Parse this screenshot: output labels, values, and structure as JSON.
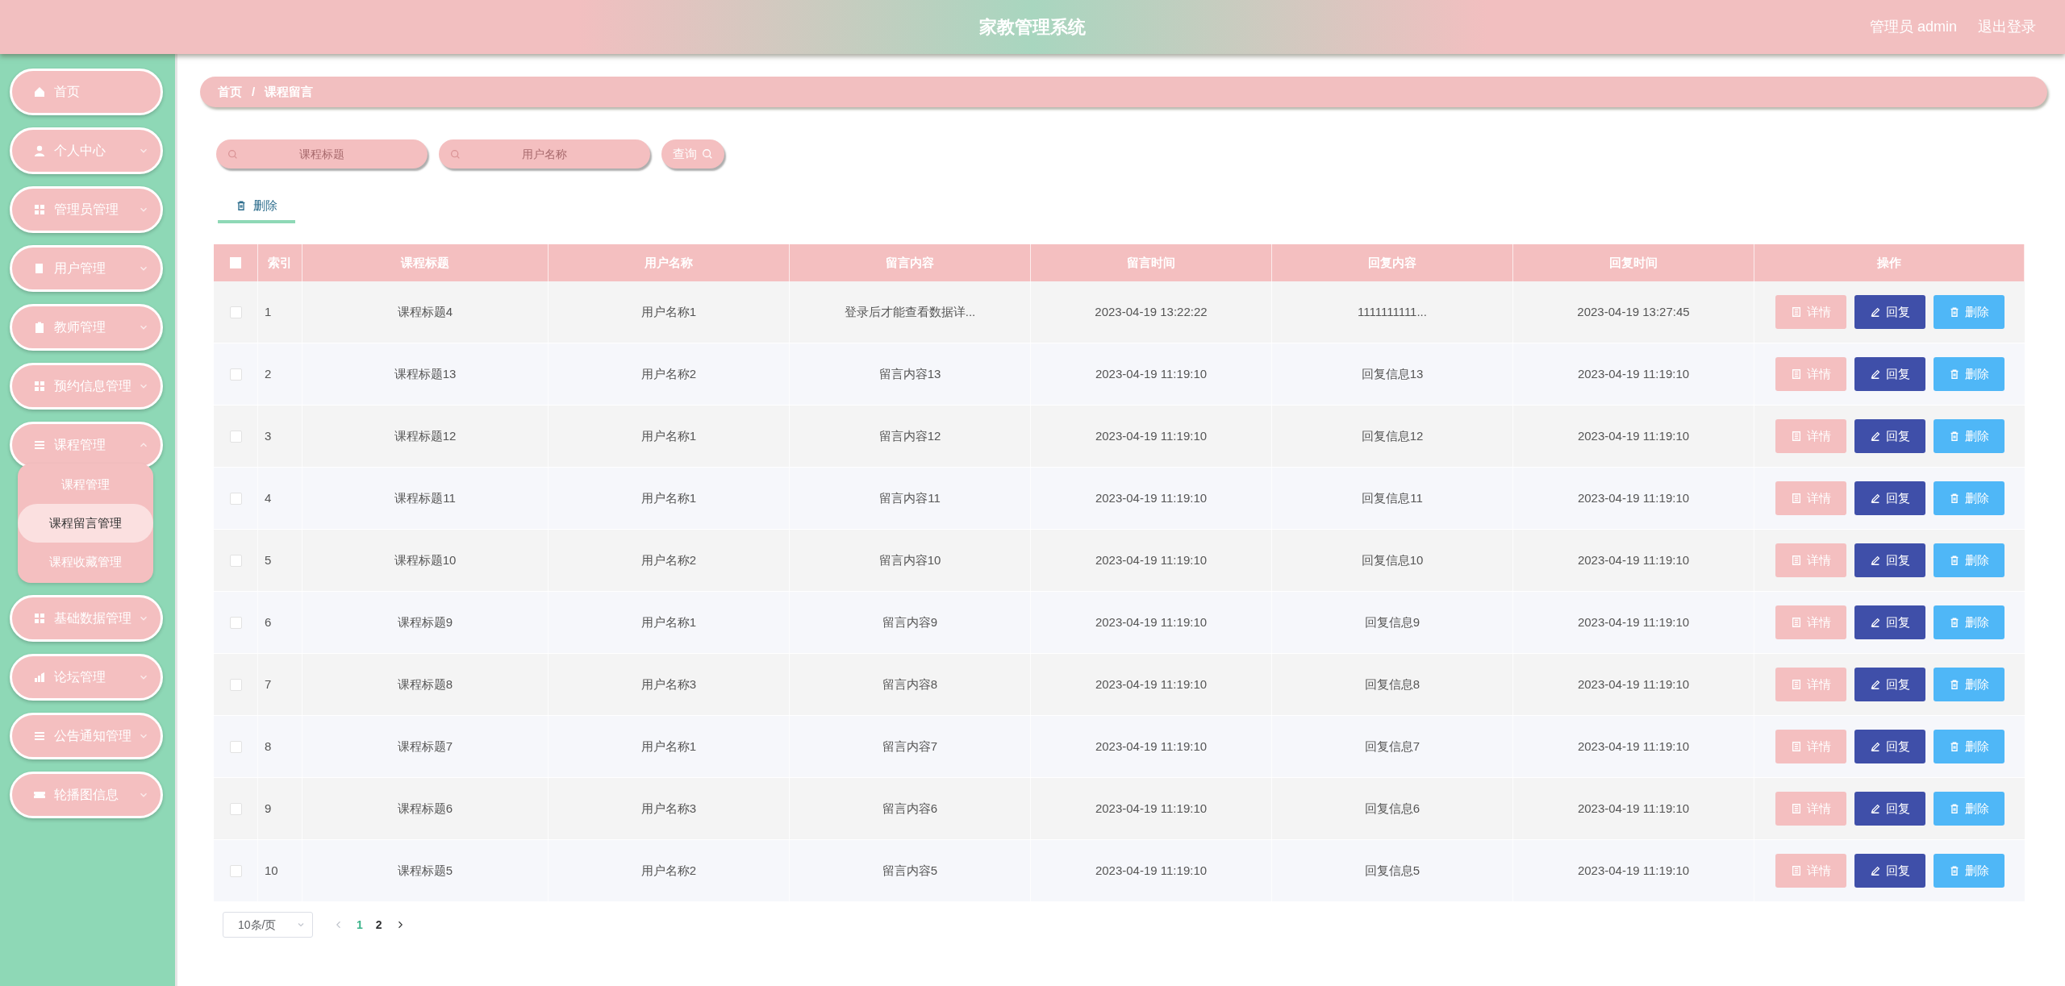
{
  "header": {
    "title": "家教管理系统",
    "user": "管理员 admin",
    "logout": "退出登录"
  },
  "sidebar": {
    "items": [
      {
        "label": "首页",
        "kind": "link"
      },
      {
        "label": "个人中心",
        "kind": "menu",
        "expanded": false
      },
      {
        "label": "管理员管理",
        "kind": "menu",
        "expanded": false
      },
      {
        "label": "用户管理",
        "kind": "menu",
        "expanded": false
      },
      {
        "label": "教师管理",
        "kind": "menu",
        "expanded": false
      },
      {
        "label": "预约信息管理",
        "kind": "menu",
        "expanded": false
      },
      {
        "label": "课程管理",
        "kind": "menu",
        "expanded": true,
        "children": [
          {
            "label": "课程管理",
            "selected": false
          },
          {
            "label": "课程留言管理",
            "selected": true
          },
          {
            "label": "课程收藏管理",
            "selected": false
          }
        ]
      },
      {
        "label": "基础数据管理",
        "kind": "menu",
        "expanded": false
      },
      {
        "label": "论坛管理",
        "kind": "menu",
        "expanded": false
      },
      {
        "label": "公告通知管理",
        "kind": "menu",
        "expanded": false
      },
      {
        "label": "轮播图信息",
        "kind": "menu",
        "expanded": false
      }
    ]
  },
  "breadcrumb": [
    "首页",
    "课程留言"
  ],
  "breadcrumb_separator": "/",
  "search": {
    "fields": [
      {
        "placeholder": "课程标题"
      },
      {
        "placeholder": "用户名称"
      }
    ],
    "button": "查询"
  },
  "toolbar": {
    "delete": "删除"
  },
  "table": {
    "select_all": {
      "checked": false
    },
    "columns": [
      "索引",
      "课程标题",
      "用户名称",
      "留言内容",
      "留言时间",
      "回复内容",
      "回复时间",
      "操作"
    ],
    "rows": [
      {
        "checked": false,
        "cells": [
          "1",
          "课程标题4",
          "用户名称1",
          "登录后才能查看数据详...",
          "2023-04-19 13:22:22",
          "1111111111...",
          "2023-04-19 13:27:45"
        ],
        "actions": [
          "详情",
          "回复",
          "删除"
        ]
      },
      {
        "checked": false,
        "cells": [
          "2",
          "课程标题13",
          "用户名称2",
          "留言内容13",
          "2023-04-19 11:19:10",
          "回复信息13",
          "2023-04-19 11:19:10"
        ],
        "actions": [
          "详情",
          "回复",
          "删除"
        ]
      },
      {
        "checked": false,
        "cells": [
          "3",
          "课程标题12",
          "用户名称1",
          "留言内容12",
          "2023-04-19 11:19:10",
          "回复信息12",
          "2023-04-19 11:19:10"
        ],
        "actions": [
          "详情",
          "回复",
          "删除"
        ]
      },
      {
        "checked": false,
        "cells": [
          "4",
          "课程标题11",
          "用户名称1",
          "留言内容11",
          "2023-04-19 11:19:10",
          "回复信息11",
          "2023-04-19 11:19:10"
        ],
        "actions": [
          "详情",
          "回复",
          "删除"
        ]
      },
      {
        "checked": false,
        "cells": [
          "5",
          "课程标题10",
          "用户名称2",
          "留言内容10",
          "2023-04-19 11:19:10",
          "回复信息10",
          "2023-04-19 11:19:10"
        ],
        "actions": [
          "详情",
          "回复",
          "删除"
        ]
      },
      {
        "checked": false,
        "cells": [
          "6",
          "课程标题9",
          "用户名称1",
          "留言内容9",
          "2023-04-19 11:19:10",
          "回复信息9",
          "2023-04-19 11:19:10"
        ],
        "actions": [
          "详情",
          "回复",
          "删除"
        ]
      },
      {
        "checked": false,
        "cells": [
          "7",
          "课程标题8",
          "用户名称3",
          "留言内容8",
          "2023-04-19 11:19:10",
          "回复信息8",
          "2023-04-19 11:19:10"
        ],
        "actions": [
          "详情",
          "回复",
          "删除"
        ]
      },
      {
        "checked": false,
        "cells": [
          "8",
          "课程标题7",
          "用户名称1",
          "留言内容7",
          "2023-04-19 11:19:10",
          "回复信息7",
          "2023-04-19 11:19:10"
        ],
        "actions": [
          "详情",
          "回复",
          "删除"
        ]
      },
      {
        "checked": false,
        "cells": [
          "9",
          "课程标题6",
          "用户名称3",
          "留言内容6",
          "2023-04-19 11:19:10",
          "回复信息6",
          "2023-04-19 11:19:10"
        ],
        "actions": [
          "详情",
          "回复",
          "删除"
        ]
      },
      {
        "checked": false,
        "cells": [
          "10",
          "课程标题5",
          "用户名称2",
          "留言内容5",
          "2023-04-19 11:19:10",
          "回复信息5",
          "2023-04-19 11:19:10"
        ],
        "actions": [
          "详情",
          "回复",
          "删除"
        ]
      }
    ]
  },
  "pagination": {
    "page_size": "10条/页",
    "pages": [
      {
        "label": "1",
        "selected": true
      },
      {
        "label": "2",
        "selected": false
      }
    ]
  }
}
